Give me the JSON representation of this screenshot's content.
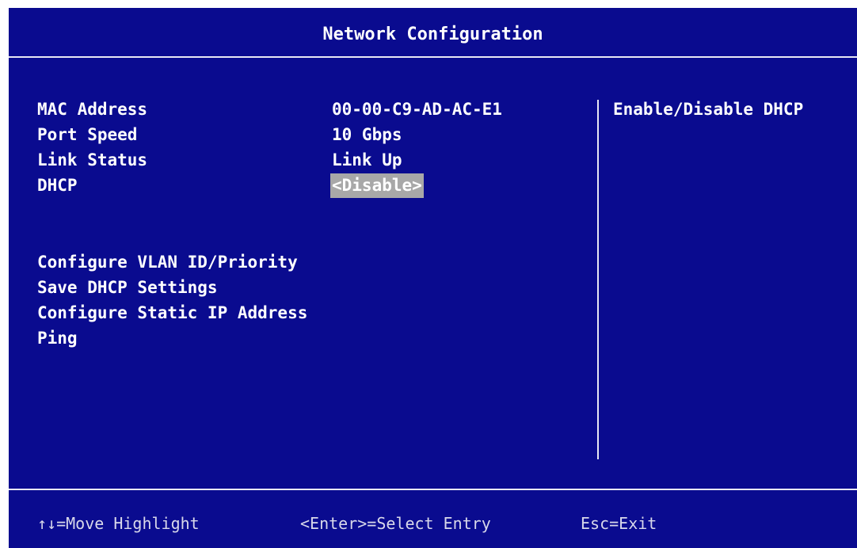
{
  "screen": {
    "title": "Network Configuration"
  },
  "settings": [
    {
      "label": "MAC Address",
      "value": "00-00-C9-AD-AC-E1"
    },
    {
      "label": "Port Speed",
      "value": "10 Gbps"
    },
    {
      "label": "Link Status",
      "value": "Link Up"
    },
    {
      "label": "DHCP",
      "value": "<Disable>"
    }
  ],
  "actions": [
    {
      "label": "Configure VLAN ID/Priority"
    },
    {
      "label": "Save DHCP Settings"
    },
    {
      "label": "Configure Static IP Address"
    },
    {
      "label": "Ping"
    }
  ],
  "help": {
    "text": "Enable/Disable DHCP"
  },
  "footer": {
    "move": "↑↓=Move Highlight",
    "select": "<Enter>=Select Entry",
    "exit": "Esc=Exit"
  },
  "colors": {
    "background": "#0a0b8f",
    "text": "#ffffff",
    "highlight": "#a8a8a8"
  }
}
